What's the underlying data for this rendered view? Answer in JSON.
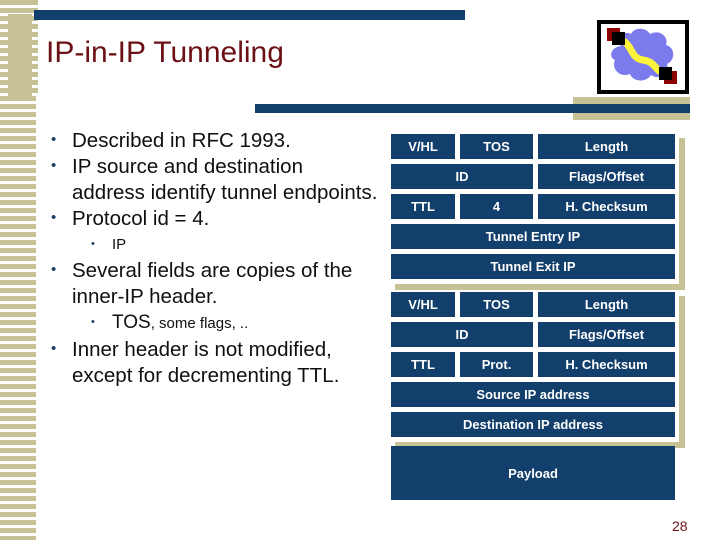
{
  "slide": {
    "title": "IP-in-IP Tunneling",
    "page_number": "28",
    "accent_blue": "#123f6b",
    "accent_tan": "#c6c295",
    "title_color": "#6b1015"
  },
  "logo": {
    "name": "network-cloud-tunnel-image",
    "cloud_color": "#7b7bee",
    "tunnel_color": "#fbf33c",
    "node_color": "#000000",
    "node_accent": "#8b0000"
  },
  "bullets": [
    {
      "level": 1,
      "text": "Described in RFC 1993."
    },
    {
      "level": 1,
      "text": "IP source and destination address identify tunnel endpoints."
    },
    {
      "level": 1,
      "text": "Protocol id = 4."
    },
    {
      "level": 2,
      "text": "IP"
    },
    {
      "level": 1,
      "text": "Several fields are copies of the inner-IP header."
    },
    {
      "level": 2,
      "text_big": "TOS",
      "text_small": ", some flags, .."
    },
    {
      "level": 1,
      "text": "Inner header is not modified, except for decrementing TTL."
    }
  ],
  "packet": {
    "outer_header": {
      "rows": [
        [
          "V/HL",
          "TOS",
          "Length"
        ],
        [
          "ID",
          "Flags/Offset"
        ],
        [
          "TTL",
          "4",
          "H. Checksum"
        ],
        [
          "Tunnel Entry IP"
        ],
        [
          "Tunnel Exit IP"
        ]
      ]
    },
    "inner_header": {
      "rows": [
        [
          "V/HL",
          "TOS",
          "Length"
        ],
        [
          "ID",
          "Flags/Offset"
        ],
        [
          "TTL",
          "Prot.",
          "H. Checksum"
        ],
        [
          "Source IP address"
        ],
        [
          "Destination IP address"
        ]
      ]
    },
    "payload": "Payload"
  }
}
